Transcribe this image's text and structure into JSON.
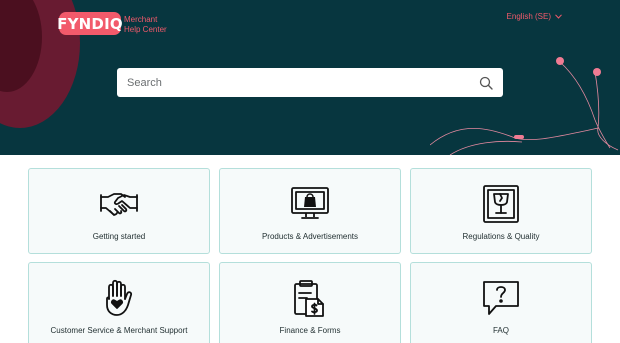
{
  "brand": {
    "logo_text": "FYNDIQ",
    "subtitle_line1": "Merchant",
    "subtitle_line2": "Help Center",
    "accent": "#f25a6b",
    "hero_bg": "#07363f"
  },
  "header": {
    "language_label": "English (SE)",
    "language_icon": "chevron-down-icon"
  },
  "search": {
    "placeholder": "Search",
    "icon": "search-icon"
  },
  "categories": [
    {
      "label": "Getting started",
      "icon": "handshake-icon"
    },
    {
      "label": "Products & Advertisements",
      "icon": "monitor-shopping-bag-icon"
    },
    {
      "label": "Regulations & Quality",
      "icon": "fragile-box-icon"
    },
    {
      "label": "Customer Service & Merchant Support",
      "icon": "hand-heart-icon"
    },
    {
      "label": "Finance & Forms",
      "icon": "clipboard-dollar-icon"
    },
    {
      "label": "FAQ",
      "icon": "question-bubble-icon"
    }
  ]
}
